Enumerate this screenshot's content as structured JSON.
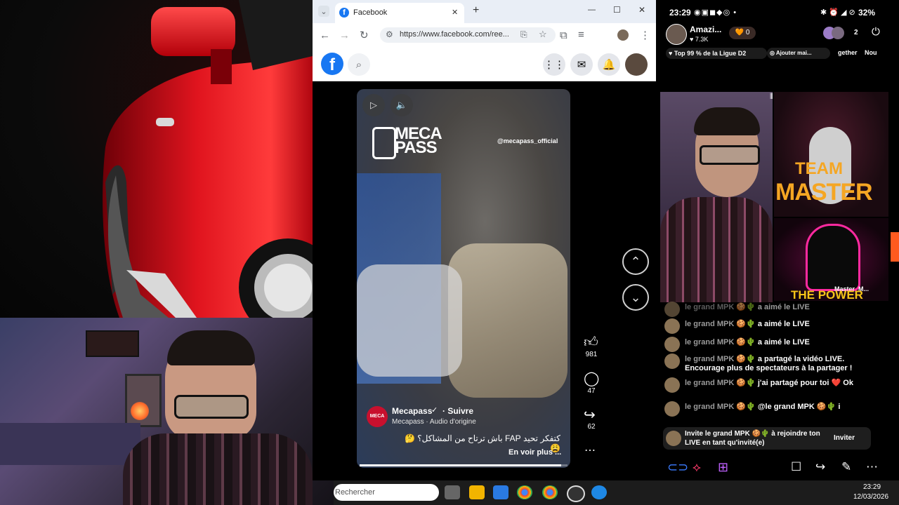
{
  "browser": {
    "tab_title": "Facebook",
    "url": "https://www.facebook.com/ree...",
    "new_tab_label": "+",
    "minimize": "—",
    "maximize": "☐",
    "close": "✕"
  },
  "reel": {
    "watermark_logo_top": "MECA",
    "watermark_logo_bottom": "PASS",
    "watermark_handle": "@mecapass_official",
    "author": "Mecapass",
    "follow": "· Suivre",
    "audio": "Mecapass · Audio d'origine",
    "caption": "كتفكر تحيد FAP باش ترتاح من المشاكل؟ 🤔😩",
    "see_more": "En voir plus ...",
    "likes": "981",
    "comments": "47",
    "shares": "62",
    "progress": 0.97
  },
  "taskbar": {
    "search_placeholder": "Rechercher",
    "time": "23:29",
    "date": "12/03/2026"
  },
  "phone": {
    "time": "23:29",
    "battery": "32%",
    "streamer": "Amazi...",
    "followers": "7.3K",
    "coin_count": "0",
    "viewer_count": "2",
    "rank_badge": "Top 99 % de la Ligue D2",
    "chip_add": "Ajouter mai...",
    "chip_together": "gether",
    "chip_new": "Nou",
    "guest_name": "Master_M...",
    "guest_banner_1": "TEAM",
    "guest_banner_1b": "MASTER",
    "guest_banner_2": "THE POWER",
    "chat": [
      {
        "name": "le grand MPK",
        "emoji": "🍪🌵",
        "text": "a aimé le LIVE",
        "faded": true
      },
      {
        "name": "le grand MPK",
        "emoji": "🍪🌵",
        "text": "a aimé le LIVE",
        "faded": false
      },
      {
        "name": "le grand MPK",
        "emoji": "🍪🌵",
        "text": "a aimé le LIVE",
        "faded": false
      },
      {
        "name": "le grand MPK",
        "emoji": "🍪🌵",
        "text": "a partagé la vidéo LIVE. Encourage plus de spectateurs à la partager !",
        "faded": false
      },
      {
        "name": "le grand MPK",
        "emoji": "🍪🌵",
        "text": "j'ai partagé pour toi ❤️ Ok",
        "faded": false
      },
      {
        "name": "le grand MPK",
        "emoji": "🍪🌵",
        "text": "@le grand MPK 🍪🌵 i",
        "faded": false
      }
    ],
    "invite_text": "Invite le grand MPK 🍪🌵 à rejoindre ton LIVE en tant qu'invité(e)",
    "invite_button": "Inviter"
  }
}
